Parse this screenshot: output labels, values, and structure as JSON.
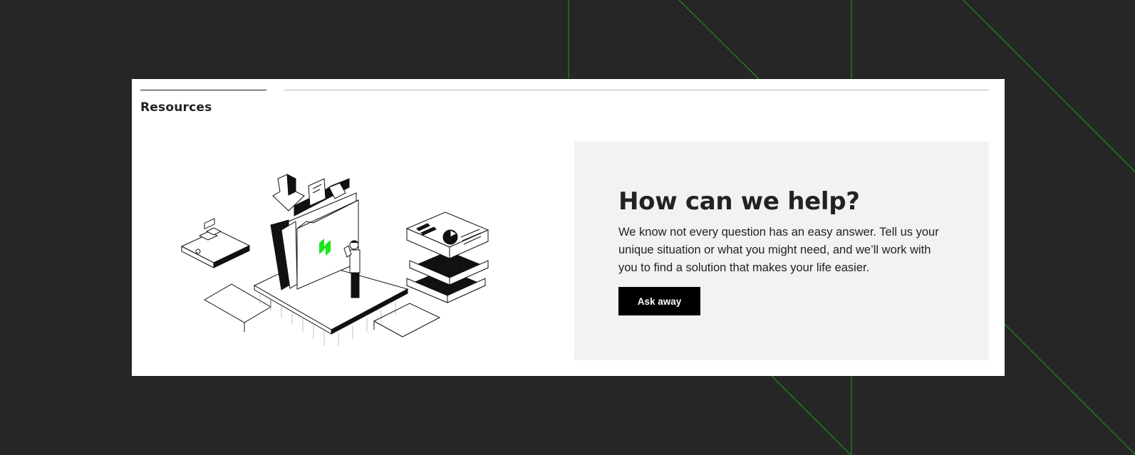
{
  "section": {
    "title": "Resources"
  },
  "help": {
    "title": "How can we help?",
    "body": "We know not every question has an easy answer. Tell us your unique situation or what you might need, and we’ll work with you to find a solution that makes your life easier.",
    "button_label": "Ask away"
  },
  "colors": {
    "background": "#262626",
    "card": "#ffffff",
    "panel": "#f2f2f2",
    "accent_green": "#19e619",
    "button": "#000000"
  },
  "icons": {
    "illustration": "isometric-resources-illustration",
    "logo_mark": "green-brand-mark"
  }
}
